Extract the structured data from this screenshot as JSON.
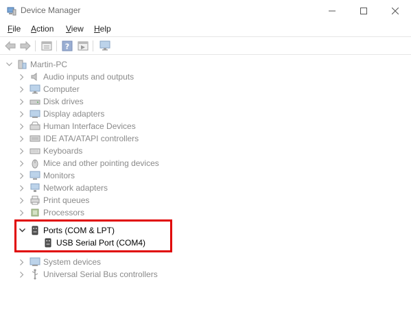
{
  "window": {
    "title": "Device Manager"
  },
  "menu": [
    {
      "key": "F",
      "rest": "ile",
      "name": "menu-file"
    },
    {
      "key": "A",
      "rest": "ction",
      "name": "menu-action"
    },
    {
      "key": "V",
      "rest": "iew",
      "name": "menu-view"
    },
    {
      "key": "H",
      "rest": "elp",
      "name": "menu-help"
    }
  ],
  "toolbar_icons": [
    "back-arrow-icon",
    "forward-arrow-icon",
    "properties-icon",
    "help-icon",
    "show-hidden-icon",
    "monitor-icon"
  ],
  "tree": {
    "root": "Martin-PC",
    "categories_before": [
      "Audio inputs and outputs",
      "Computer",
      "Disk drives",
      "Display adapters",
      "Human Interface Devices",
      "IDE ATA/ATAPI controllers",
      "Keyboards",
      "Mice and other pointing devices",
      "Monitors",
      "Network adapters",
      "Print queues",
      "Processors"
    ],
    "expanded": {
      "label": "Ports (COM & LPT)",
      "child": "USB Serial Port (COM4)"
    },
    "categories_after": [
      "System devices",
      "Universal Serial Bus controllers"
    ]
  },
  "colors": {
    "highlight": "#e00000",
    "muted_text": "#8a8a8a"
  }
}
